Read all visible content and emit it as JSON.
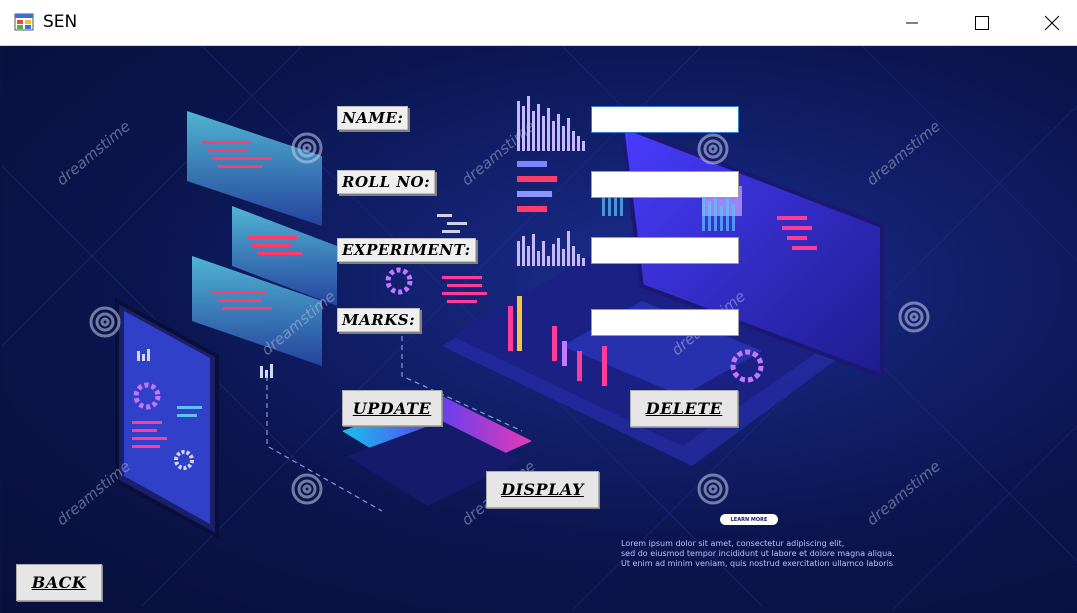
{
  "window": {
    "title": "SEN",
    "icon": "windows-form-icon"
  },
  "controls": {
    "minimize": "minimize-icon",
    "maximize": "maximize-icon",
    "close": "close-icon"
  },
  "form": {
    "name_label": "NAME:",
    "roll_label": "ROLL NO:",
    "experiment_label": "EXPERIMENT:",
    "marks_label": "MARKS:",
    "name_value": "",
    "roll_value": "",
    "experiment_value": "",
    "marks_value": ""
  },
  "buttons": {
    "update": "UPDATE",
    "delete": "DELETE",
    "display": "DISPLAY",
    "back": "BACK"
  },
  "background": {
    "watermark": "dreamstime",
    "learn_more": "LEARN MORE",
    "lorem": [
      "Lorem ipsum dolor sit amet, consectetur adipiscing elit,",
      "sed do eiusmod tempor incididunt ut labore et dolore magna aliqua.",
      "Ut enim ad minim veniam, quis nostrud exercitation ullamco laboris"
    ]
  },
  "colors": {
    "accent": "#2f7cd6",
    "background": "#0a1442"
  }
}
